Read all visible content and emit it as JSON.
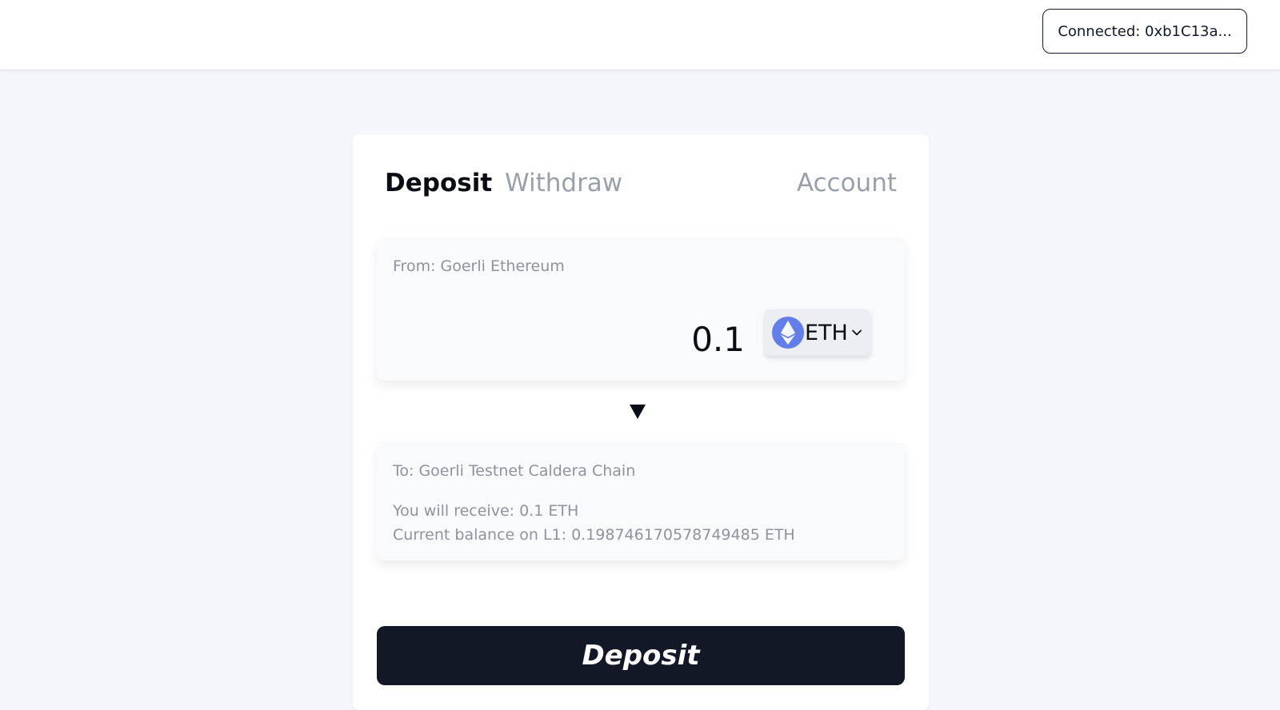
{
  "header": {
    "connect_label": "Connected: 0xb1C13a..."
  },
  "tabs": {
    "deposit": "Deposit",
    "withdraw": "Withdraw",
    "account": "Account"
  },
  "from_panel": {
    "label": "From: Goerli Ethereum",
    "amount": "0.1",
    "token": "ETH",
    "token_icon": "ethereum-icon"
  },
  "to_panel": {
    "label": "To: Goerli Testnet Caldera Chain",
    "receive": "You will receive: 0.1 ETH",
    "balance": "Current balance on L1: 0.198746170578749485 ETH"
  },
  "deposit_button": {
    "label": "Deposit"
  },
  "colors": {
    "background": "#f4f6f9",
    "button_dark": "#121826",
    "eth_blue": "#627eea",
    "muted_text": "#8e939c"
  }
}
